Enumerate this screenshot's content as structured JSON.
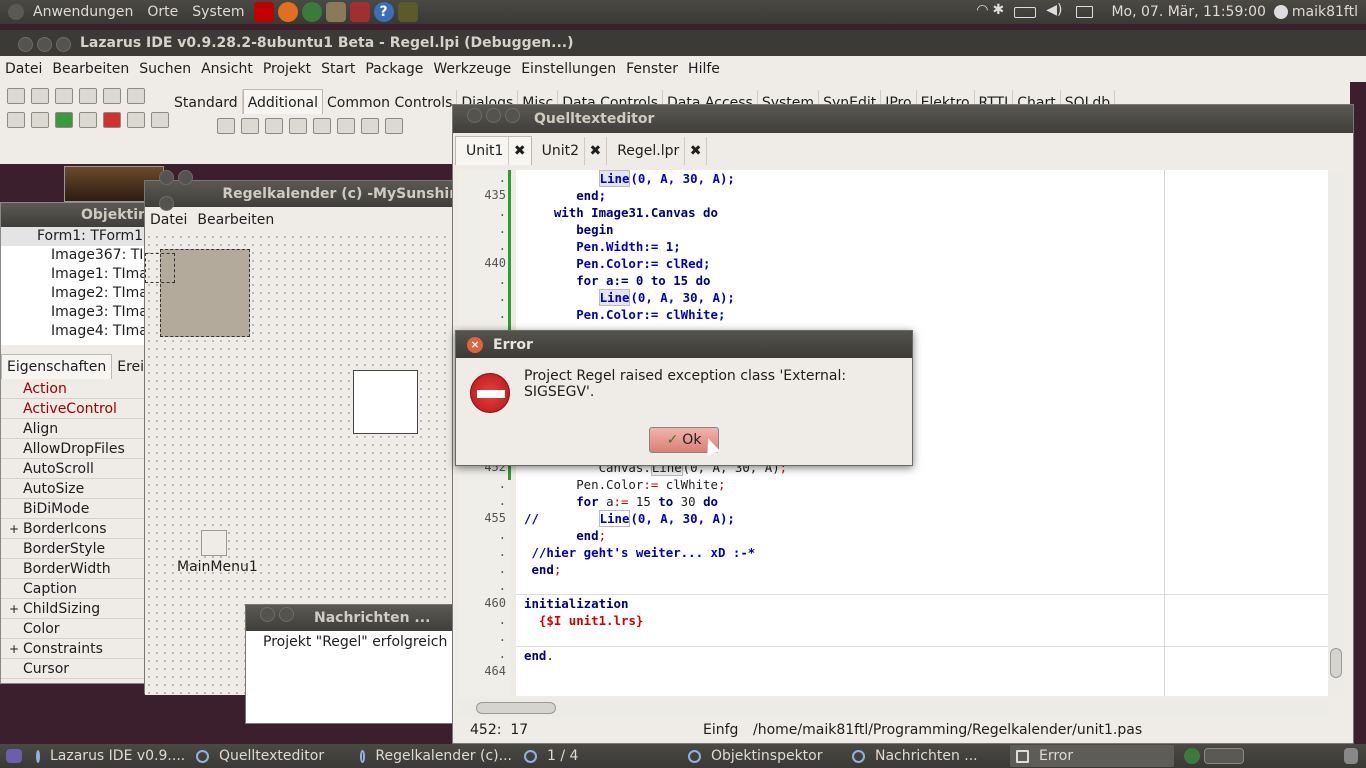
{
  "top_panel": {
    "menus": [
      "Anwendungen",
      "Orte",
      "System"
    ],
    "clock": "Mo, 07. Mär, 11:59:00",
    "user": "maik81ftl"
  },
  "lazarus": {
    "title": "Lazarus IDE v0.9.28.2-8ubuntu1 Beta - Regel.lpi (Debuggen...)",
    "menu": [
      "Datei",
      "Bearbeiten",
      "Suchen",
      "Ansicht",
      "Projekt",
      "Start",
      "Package",
      "Werkzeuge",
      "Einstellungen",
      "Fenster",
      "Hilfe"
    ],
    "palette_tabs": [
      "Standard",
      "Additional",
      "Common Controls",
      "Dialogs",
      "Misc",
      "Data Controls",
      "Data Access",
      "System",
      "SynEdit",
      "IPro",
      "Elektro",
      "RTTI",
      "Chart",
      "SQLdb"
    ],
    "palette_active": "Additional"
  },
  "objektinspektor": {
    "title": "Objektinspektor",
    "tree": [
      "Form1: TForm1",
      "Image367: TImage",
      "Image1: TImage",
      "Image2: TImage",
      "Image3: TImage",
      "Image4: TImage"
    ],
    "tabs": [
      "Eigenschaften",
      "Ereignisse"
    ],
    "props": [
      {
        "name": "Action",
        "red": true,
        "expand": false
      },
      {
        "name": "ActiveControl",
        "red": true,
        "expand": false
      },
      {
        "name": "Align",
        "red": false,
        "expand": false
      },
      {
        "name": "AllowDropFiles",
        "red": false,
        "expand": false
      },
      {
        "name": "AutoScroll",
        "red": false,
        "expand": false
      },
      {
        "name": "AutoSize",
        "red": false,
        "expand": false
      },
      {
        "name": "BiDiMode",
        "red": false,
        "expand": false
      },
      {
        "name": "BorderIcons",
        "red": false,
        "expand": true
      },
      {
        "name": "BorderStyle",
        "red": false,
        "expand": false
      },
      {
        "name": "BorderWidth",
        "red": false,
        "expand": false
      },
      {
        "name": "Caption",
        "red": false,
        "expand": false
      },
      {
        "name": "ChildSizing",
        "red": false,
        "expand": true
      },
      {
        "name": "Color",
        "red": false,
        "expand": false
      },
      {
        "name": "Constraints",
        "red": false,
        "expand": true
      },
      {
        "name": "Cursor",
        "red": false,
        "expand": false
      }
    ]
  },
  "regelkalender": {
    "title": "Regelkalender (c) -MySunshine",
    "menu": [
      "Datei",
      "Bearbeiten"
    ],
    "component_label": "MainMenu1"
  },
  "nachrichten": {
    "title": "Nachrichten ...",
    "message": "Projekt \"Regel\" erfolgreich ge"
  },
  "editor": {
    "title": "Quelltexteditor",
    "tabs": [
      "Unit1",
      "Unit2",
      "Regel.lpr"
    ],
    "active_tab": "Unit1",
    "gutter": [
      ".",
      "435",
      ".",
      ".",
      ".",
      "440",
      ".",
      ".",
      ".",
      ".",
      ".",
      ".",
      ".",
      ".",
      ".",
      ".",
      ".",
      "452",
      ".",
      ".",
      "455",
      ".",
      ".",
      ".",
      ".",
      "460",
      ".",
      ".",
      ".",
      "464"
    ],
    "status_pos": "452:  17",
    "status_mode": "Einfg",
    "status_file": "/home/maik81ftl/Programming/Regelkalender/unit1.pas"
  },
  "error_dialog": {
    "title": "Error",
    "message": "Project Regel raised exception class 'External: SIGSEGV'.",
    "ok_label": "Ok"
  },
  "taskbar": [
    "Lazarus IDE v0.9....",
    "Quelltexteditor",
    "Regelkalender (c)...",
    "1 / 4",
    "Objektinspektor",
    "Nachrichten ...",
    "Error"
  ]
}
